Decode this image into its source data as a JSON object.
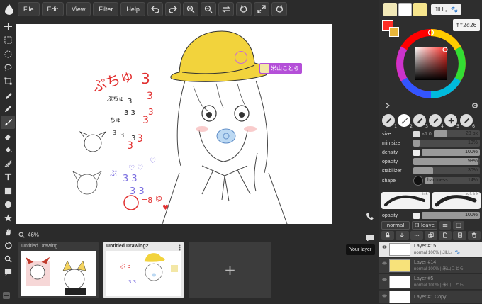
{
  "menu": {
    "file": "File",
    "edit": "Edit",
    "view": "View",
    "filter": "Filter",
    "help": "Help"
  },
  "zoom": {
    "level": "46%"
  },
  "drawings": [
    {
      "title": "Untitled Drawing"
    },
    {
      "title": "Untitled Drawing2"
    }
  ],
  "new_drawing": "+",
  "canvas_labels": {
    "user_tag": "米山ことら"
  },
  "collab": {
    "user_name": "JILL。🐾"
  },
  "color": {
    "hex": "ff2d26",
    "primary": "#ff2d26",
    "secondary": "#e8b63b"
  },
  "brush_presets": [
    "1",
    "2",
    "3",
    "4",
    "5",
    "6"
  ],
  "brush": {
    "size": {
      "label": "size",
      "value": "28 px",
      "mult": "×1.0"
    },
    "min_size": {
      "label": "min size",
      "value": "10%"
    },
    "density": {
      "label": "density",
      "value": "100%"
    },
    "opacity": {
      "label": "opacity",
      "value": "98%"
    },
    "stabilizer": {
      "label": "stabilizer",
      "value": "30%"
    },
    "shape": {
      "label": "shape",
      "hardness_label": "hardness",
      "hardness": "14%"
    }
  },
  "brush_strokes": {
    "ink": "ink",
    "soft_ink": "soft ink"
  },
  "layer_opacity": {
    "label": "opacity",
    "value": "100%"
  },
  "blend": {
    "mode": "normal",
    "leave": "leave"
  },
  "layers": [
    {
      "name": "Layer #15",
      "meta": "normal 100% | JILL。🐾",
      "active": true
    },
    {
      "name": "Layer #14",
      "meta": "normal 100% | 米山ことら",
      "active": false
    },
    {
      "name": "Layer #5",
      "meta": "normal 100% | 米山ことら",
      "active": false
    },
    {
      "name": "Layer #1 Copy",
      "meta": "",
      "active": false
    }
  ],
  "tooltip": "Your layer"
}
